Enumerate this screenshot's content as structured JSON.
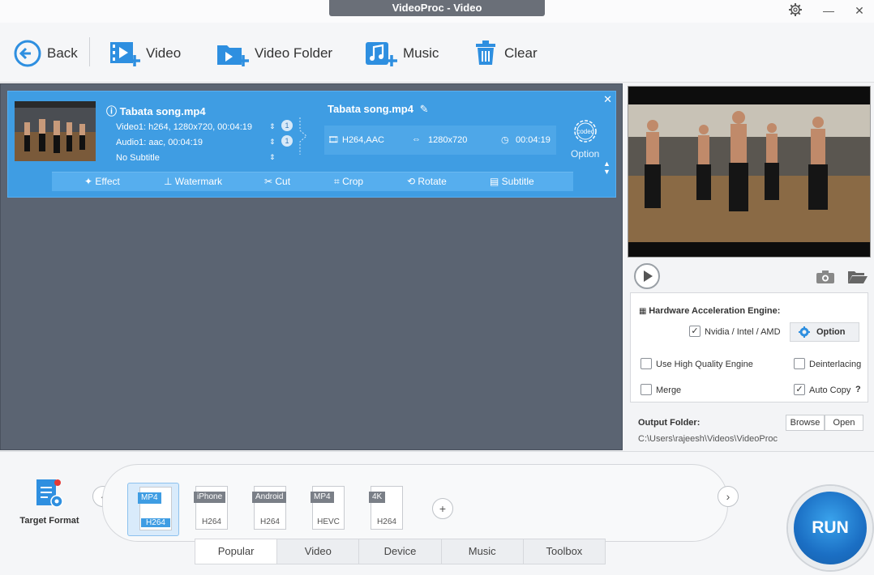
{
  "window": {
    "title": "VideoProc - Video",
    "settings_icon": "gear-icon",
    "minimize": "—",
    "close": "✕"
  },
  "toolbar": {
    "back": "Back",
    "video": "Video",
    "video_folder": "Video Folder",
    "music": "Music",
    "clear": "Clear"
  },
  "item": {
    "source_title": "Tabata song.mp4",
    "video_info": "Video1: h264, 1280x720, 00:04:19",
    "audio_info": "Audio1: aac, 00:04:19",
    "subtitle_info": "No Subtitle",
    "video_track_count": "1",
    "audio_track_count": "1",
    "output_title": "Tabata song.mp4",
    "output_codec": "H264,AAC",
    "output_resolution": "1280x720",
    "output_duration": "00:04:19",
    "codec_label": "codec",
    "option_label": "Option",
    "edit_tools": [
      "Effect",
      "Watermark",
      "Cut",
      "Crop",
      "Rotate",
      "Subtitle"
    ]
  },
  "hardware": {
    "title": "Hardware Acceleration Engine:",
    "nvidia_label": "Nvidia / Intel / AMD",
    "nvidia_checked": true,
    "option_button": "Option",
    "high_quality_label": "Use High Quality Engine",
    "high_quality_checked": false,
    "deinterlacing_label": "Deinterlacing",
    "deinterlacing_checked": false,
    "merge_label": "Merge",
    "merge_checked": false,
    "auto_copy_label": "Auto Copy",
    "auto_copy_checked": true,
    "help": "?"
  },
  "output": {
    "label": "Output Folder:",
    "path": "C:\\Users\\rajeesh\\Videos\\VideoProc",
    "browse": "Browse",
    "open": "Open"
  },
  "bottom": {
    "target_format_label": "Target Format",
    "formats": [
      {
        "top": "MP4",
        "bottom": "H264",
        "selected": true
      },
      {
        "top": "iPhone",
        "bottom": "H264",
        "selected": false
      },
      {
        "top": "Android",
        "bottom": "H264",
        "selected": false
      },
      {
        "top": "MP4",
        "bottom": "HEVC",
        "selected": false
      },
      {
        "top": "4K",
        "bottom": "H264",
        "selected": false
      }
    ],
    "tabs": [
      "Popular",
      "Video",
      "Device",
      "Music",
      "Toolbox"
    ],
    "active_tab": "Popular",
    "run": "RUN"
  },
  "colors": {
    "accent": "#3f9de3",
    "list_bg": "#5b6472",
    "run": "#1b6fc4"
  }
}
